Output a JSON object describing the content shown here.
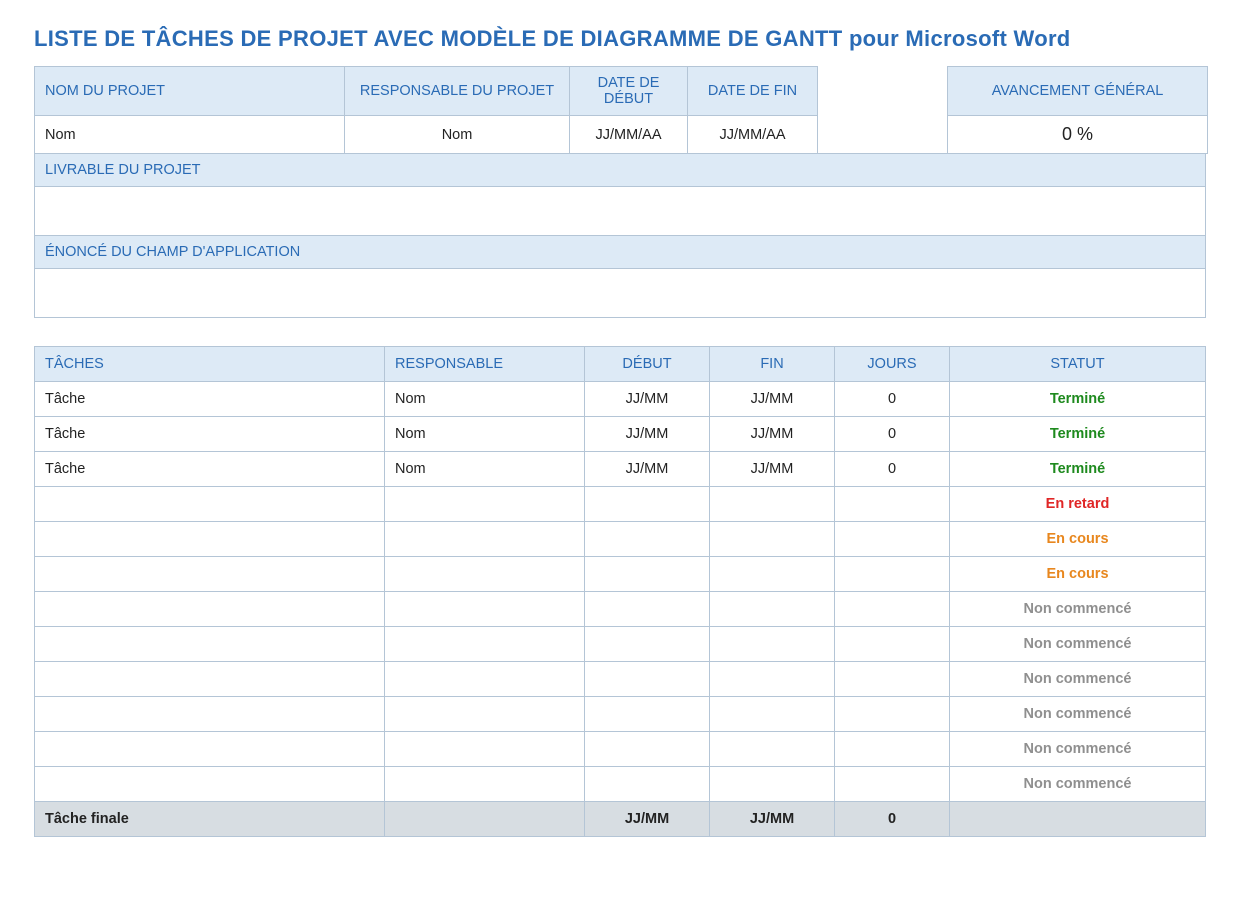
{
  "title": "LISTE DE TÂCHES DE PROJET AVEC MODÈLE DE DIAGRAMME DE GANTT pour Microsoft Word",
  "meta": {
    "headers": {
      "project_name": "NOM DU PROJET",
      "manager": "RESPONSABLE DU PROJET",
      "start": "DATE DE DÉBUT",
      "end": "DATE DE FIN",
      "overall": "AVANCEMENT GÉNÉRAL"
    },
    "values": {
      "project_name": "Nom",
      "manager": "Nom",
      "start": "JJ/MM/AA",
      "end": "JJ/MM/AA",
      "overall": "0 %"
    }
  },
  "sections": {
    "deliverable_hdr": "LIVRABLE DU PROJET",
    "deliverable_val": "",
    "scope_hdr": "ÉNONCÉ DU CHAMP D'APPLICATION",
    "scope_val": ""
  },
  "tasks": {
    "headers": {
      "task": "TÂCHES",
      "owner": "RESPONSABLE",
      "start": "DÉBUT",
      "end": "FIN",
      "days": "JOURS",
      "status": "STATUT"
    },
    "rows": [
      {
        "task": "Tâche",
        "owner": "Nom",
        "start": "JJ/MM",
        "end": "JJ/MM",
        "days": "0",
        "status": "Terminé",
        "status_kind": "complete"
      },
      {
        "task": "Tâche",
        "owner": "Nom",
        "start": "JJ/MM",
        "end": "JJ/MM",
        "days": "0",
        "status": "Terminé",
        "status_kind": "complete"
      },
      {
        "task": "Tâche",
        "owner": "Nom",
        "start": "JJ/MM",
        "end": "JJ/MM",
        "days": "0",
        "status": "Terminé",
        "status_kind": "complete"
      },
      {
        "task": "",
        "owner": "",
        "start": "",
        "end": "",
        "days": "",
        "status": "En retard",
        "status_kind": "late"
      },
      {
        "task": "",
        "owner": "",
        "start": "",
        "end": "",
        "days": "",
        "status": "En cours",
        "status_kind": "progress"
      },
      {
        "task": "",
        "owner": "",
        "start": "",
        "end": "",
        "days": "",
        "status": "En cours",
        "status_kind": "progress"
      },
      {
        "task": "",
        "owner": "",
        "start": "",
        "end": "",
        "days": "",
        "status": "Non commencé",
        "status_kind": "notstart"
      },
      {
        "task": "",
        "owner": "",
        "start": "",
        "end": "",
        "days": "",
        "status": "Non commencé",
        "status_kind": "notstart"
      },
      {
        "task": "",
        "owner": "",
        "start": "",
        "end": "",
        "days": "",
        "status": "Non commencé",
        "status_kind": "notstart"
      },
      {
        "task": "",
        "owner": "",
        "start": "",
        "end": "",
        "days": "",
        "status": "Non commencé",
        "status_kind": "notstart"
      },
      {
        "task": "",
        "owner": "",
        "start": "",
        "end": "",
        "days": "",
        "status": "Non commencé",
        "status_kind": "notstart"
      },
      {
        "task": "",
        "owner": "",
        "start": "",
        "end": "",
        "days": "",
        "status": "Non commencé",
        "status_kind": "notstart"
      }
    ],
    "final": {
      "task": "Tâche finale",
      "owner": "",
      "start": "JJ/MM",
      "end": "JJ/MM",
      "days": "0",
      "status": ""
    }
  },
  "colors": {
    "accent_blue": "#2a6bb5",
    "header_fill": "#ddeaf6",
    "border": "#b4c5d6",
    "status_complete": "#1e8a1e",
    "status_late": "#e02626",
    "status_progress": "#e8871e",
    "status_notstart": "#8f8f8f",
    "final_fill": "#d7dde2"
  }
}
